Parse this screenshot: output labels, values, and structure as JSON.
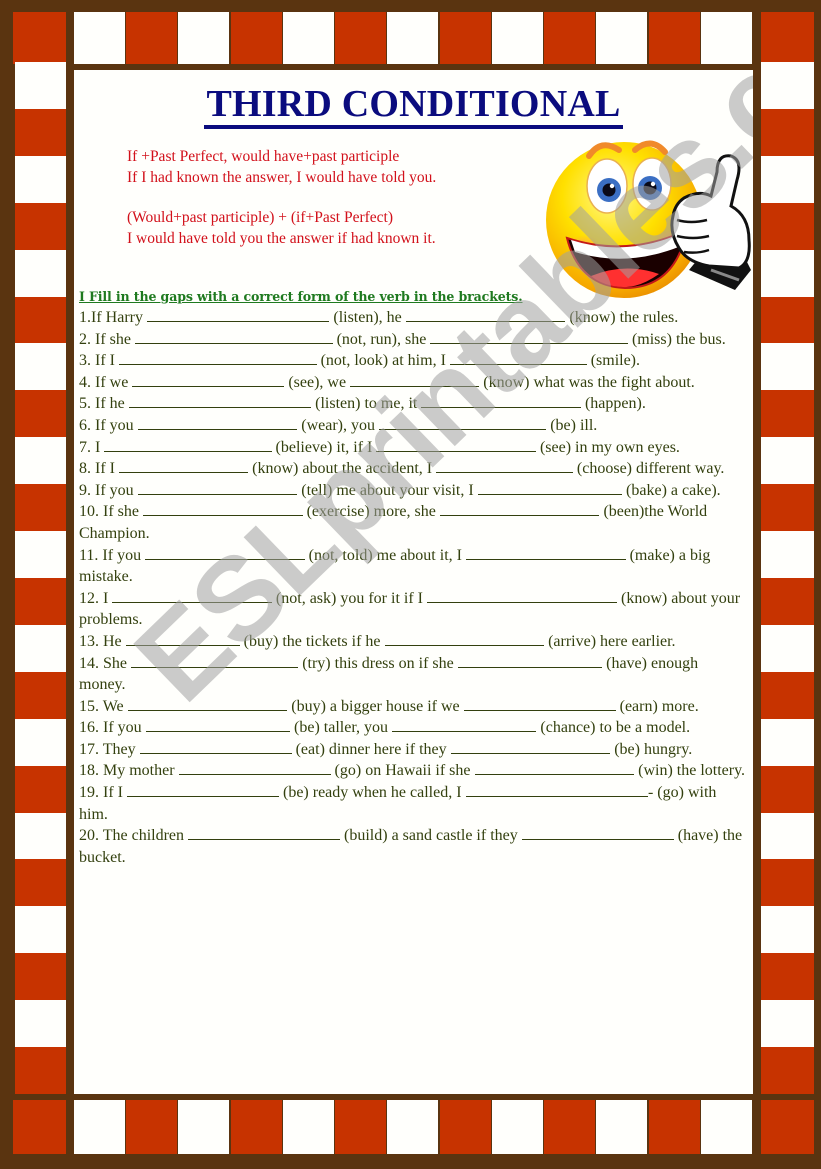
{
  "title": "THIRD CONDITIONAL",
  "colors": {
    "frame": "#5a3410",
    "border_red": "#c73300",
    "border_white": "#fffffc",
    "title": "#0b0c7e",
    "rule_text": "#d2101a",
    "instruction": "#1f7a1f",
    "exercise_text": "#33400e"
  },
  "rules": [
    {
      "formula": "If +Past Perfect, would have+past participle",
      "example": "If I had known the answer, I would have told you."
    },
    {
      "formula": "(Would+past participle) + (if+Past Perfect)",
      "example": "I would have told you the answer if had known it."
    }
  ],
  "illustration": "thumbs-up-smiley-icon",
  "instruction": "I Fill in the gaps with a correct form of the verb in the brackets.",
  "exercises": [
    {
      "parts": [
        "1.If Harry ",
        " (listen), he ",
        " (know) the rules."
      ],
      "blanks": [
        24,
        21
      ]
    },
    {
      "parts": [
        "2. If she ",
        " (not, run), she ",
        " (miss) the bus."
      ],
      "blanks": [
        26,
        26
      ]
    },
    {
      "parts": [
        "3. If I ",
        " (not, look) at him, I ",
        " (smile)."
      ],
      "blanks": [
        26,
        18
      ]
    },
    {
      "parts": [
        "4. If we ",
        " (see), we ",
        " (know) what was the fight about."
      ],
      "blanks": [
        20,
        17
      ]
    },
    {
      "parts": [
        "5. If he ",
        " (listen) to me, it ",
        " (happen)."
      ],
      "blanks": [
        24,
        21
      ]
    },
    {
      "parts": [
        "6. If you ",
        " (wear), you ",
        " (be) ill."
      ],
      "blanks": [
        21,
        22
      ]
    },
    {
      "parts": [
        "7. I ",
        " (believe) it, if I ",
        " (see) in my own eyes."
      ],
      "blanks": [
        22,
        21
      ]
    },
    {
      "parts": [
        "8. If I ",
        " (know) about the accident, I ",
        " (choose) different way."
      ],
      "blanks": [
        17,
        18
      ]
    },
    {
      "parts": [
        "9. If you ",
        " (tell) me about your visit, I ",
        " (bake) a cake)."
      ],
      "blanks": [
        21,
        19
      ]
    },
    {
      "parts": [
        "10. If she ",
        " (exercise) more, she ",
        " (been)the World Champion."
      ],
      "blanks": [
        21,
        21
      ]
    },
    {
      "parts": [
        "11. If you ",
        " (not, told) me about it, I ",
        " (make) a big mistake."
      ],
      "blanks": [
        21,
        21
      ]
    },
    {
      "parts": [
        "12. I ",
        " (not, ask) you for it if I ",
        " (know) about your problems."
      ],
      "blanks": [
        21,
        25
      ]
    },
    {
      "parts": [
        "13. He ",
        " (buy) the tickets if he ",
        " (arrive) here earlier."
      ],
      "blanks": [
        15,
        21
      ]
    },
    {
      "parts": [
        "14. She ",
        " (try) this dress on if she ",
        " (have) enough  money."
      ],
      "blanks": [
        22,
        19
      ]
    },
    {
      "parts": [
        "15. We ",
        " (buy) a bigger house if we ",
        " (earn) more."
      ],
      "blanks": [
        21,
        20
      ]
    },
    {
      "parts": [
        "16. If you ",
        " (be) taller, you ",
        " (chance) to be a model."
      ],
      "blanks": [
        19,
        19
      ]
    },
    {
      "parts": [
        "17. They ",
        " (eat) dinner here if they ",
        " (be) hungry."
      ],
      "blanks": [
        20,
        21
      ]
    },
    {
      "parts": [
        "18. My mother ",
        " (go) on Hawaii if she ",
        " (win) the lottery."
      ],
      "blanks": [
        20,
        21
      ]
    },
    {
      "parts": [
        "19. If I ",
        " (be) ready when he called, I ",
        "- (go) with him."
      ],
      "blanks": [
        20,
        24
      ]
    },
    {
      "parts": [
        "20. The children ",
        " (build) a sand castle if they ",
        " (have) the bucket."
      ],
      "blanks": [
        20,
        20
      ]
    }
  ],
  "watermark": "ESLprintables.com"
}
